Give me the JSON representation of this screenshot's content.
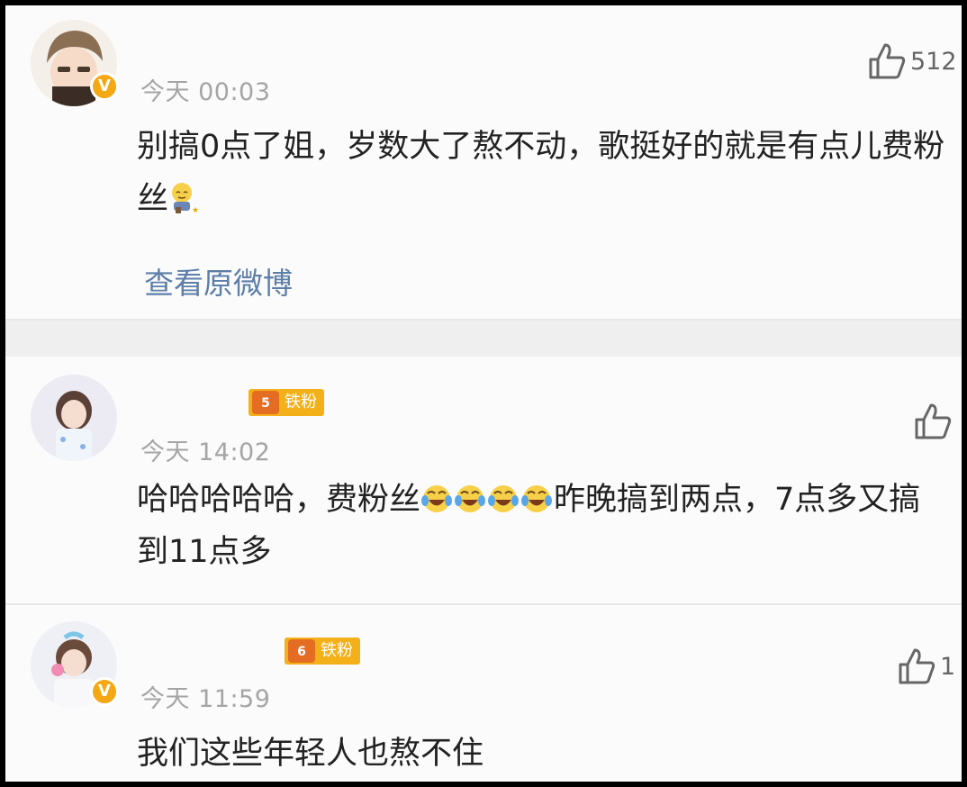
{
  "comments": [
    {
      "time": "今天 00:03",
      "text_main": "别搞0点了姐，岁数大了熬不动，歌挺好的就是有点儿费粉丝",
      "like_count": "512",
      "link": "查看原微博",
      "verified_badge": "V"
    },
    {
      "fan_badge": {
        "level": "5",
        "label": "铁粉"
      },
      "time": "今天 14:02",
      "text_before": "哈哈哈哈哈，费粉丝",
      "text_after": "昨晚搞到两点，7点多又搞到11点多",
      "like_count": ""
    },
    {
      "fan_badge": {
        "level": "6",
        "label": "铁粉"
      },
      "time": "今天 11:59",
      "text": "我们这些年轻人也熬不住",
      "like_count": "1",
      "verified_badge": "V"
    }
  ],
  "icons": {
    "like": "thumbs-up-icon",
    "emoji_sweat": "sweat-smile-emoji",
    "emoji_laugh_cry": "laugh-cry-emoji"
  },
  "colors": {
    "verified": "#f3a814",
    "fan_badge": "#f4b018",
    "link": "#5d7ea8"
  }
}
